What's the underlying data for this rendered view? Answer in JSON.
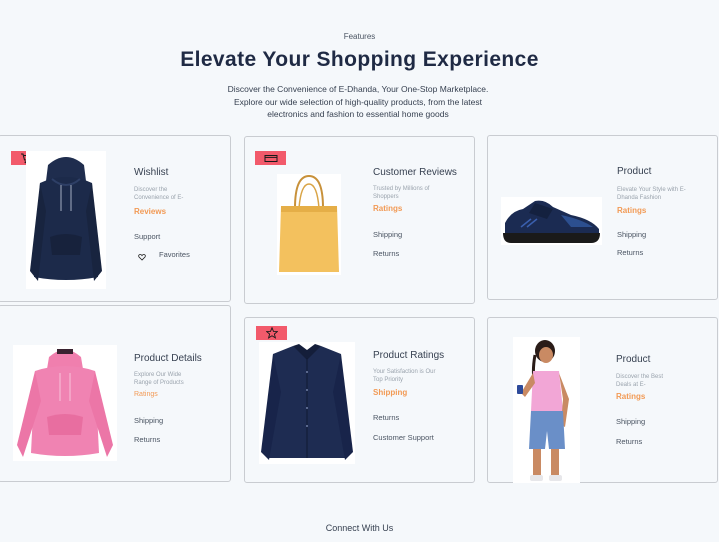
{
  "header": {
    "eyebrow": "Features",
    "title": "Elevate Your Shopping Experience",
    "subtitle": "Discover the Convenience of E-Dhanda, Your One-Stop Marketplace. Explore our wide selection of high-quality products, from the latest electronics and fashion to essential home goods"
  },
  "cards": [
    {
      "title": "Wishlist",
      "desc": "Discover the Convenience of E-",
      "rating": "Reviews",
      "link1": "Support",
      "link2": "Favorites",
      "badge_icon": "cart-icon",
      "product": "navy-hoodie"
    },
    {
      "title": "Customer Reviews",
      "desc": "Trusted by Millions of Shoppers",
      "rating": "Ratings",
      "link1": "Shipping",
      "link2": "Returns",
      "badge_icon": "card-icon",
      "product": "tote-bag"
    },
    {
      "title": "Product",
      "desc": "Elevate Your Style with E-Dhanda Fashion",
      "rating": "Ratings",
      "link1": "Shipping",
      "link2": "Returns",
      "badge_icon": "",
      "product": "sneaker"
    },
    {
      "title": "Product Details",
      "desc": "Explore Our Wide Range of Products",
      "rating": "Ratings",
      "link1": "Shipping",
      "link2": "Returns",
      "badge_icon": "",
      "product": "pink-hoodie"
    },
    {
      "title": "Product Ratings",
      "desc": "Your Satisfaction is Our Top Priority",
      "rating": "Shipping",
      "link1": "Returns",
      "link2": "Customer Support",
      "badge_icon": "star-icon",
      "product": "navy-shirt"
    },
    {
      "title": "Product",
      "desc": "Discover the Best Deals at E-",
      "rating": "Ratings",
      "link1": "Shipping",
      "link2": "Returns",
      "badge_icon": "",
      "product": "woman-shopper"
    }
  ],
  "footer": {
    "label": "Connect With Us"
  },
  "colors": {
    "badge": "#f25a6b",
    "rating": "#f29a55",
    "title": "#1f2a44",
    "navy": "#1c2a4a",
    "pink": "#f07fae",
    "tote": "#f3c15e"
  }
}
